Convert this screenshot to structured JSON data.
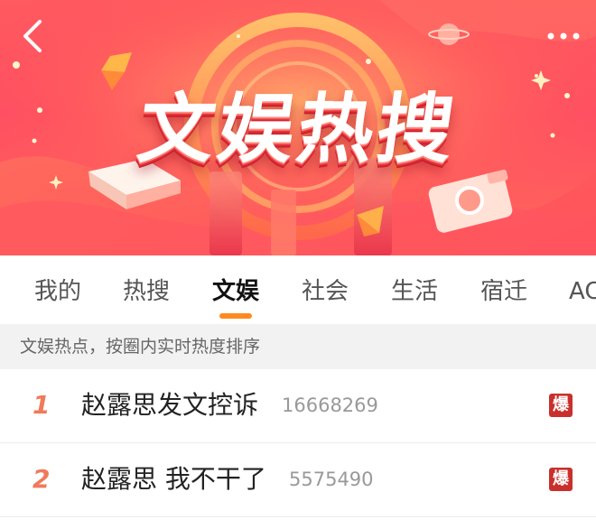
{
  "banner": {
    "title": "文娱热搜",
    "back_icon": "chevron-left-icon",
    "more_icon": "more-dots-icon"
  },
  "tabs": [
    {
      "label": "我的",
      "active": false
    },
    {
      "label": "热搜",
      "active": false
    },
    {
      "label": "文娱",
      "active": true
    },
    {
      "label": "社会",
      "active": false
    },
    {
      "label": "生活",
      "active": false
    },
    {
      "label": "宿迁",
      "active": false
    },
    {
      "label": "AC",
      "active": false
    }
  ],
  "subheader": {
    "text": "文娱热点，按圈内实时热度排序"
  },
  "list": [
    {
      "rank": "1",
      "title": "赵露思发文控诉",
      "count": "16668269",
      "badge": "爆"
    },
    {
      "rank": "2",
      "title": "赵露思 我不干了",
      "count": "5575490",
      "badge": "爆"
    }
  ],
  "colors": {
    "accent": "#ff8a1f",
    "rank": "#f07a5a",
    "badge": "#c9302c",
    "banner": "#ff5a5f"
  }
}
